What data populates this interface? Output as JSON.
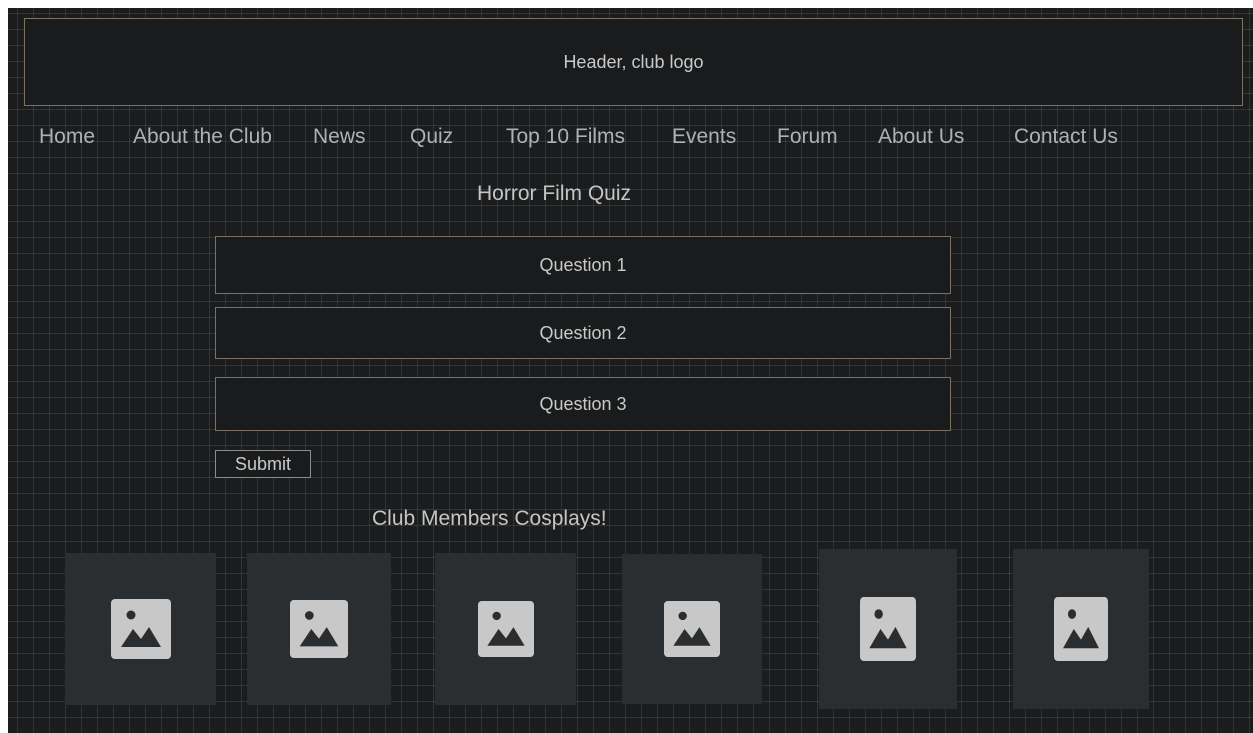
{
  "header": {
    "text": "Header, club logo"
  },
  "nav": {
    "items": [
      {
        "label": "Home"
      },
      {
        "label": "About the Club"
      },
      {
        "label": "News"
      },
      {
        "label": "Quiz"
      },
      {
        "label": "Top 10 Films"
      },
      {
        "label": "Events"
      },
      {
        "label": "Forum"
      },
      {
        "label": "About Us"
      },
      {
        "label": "Contact Us"
      }
    ]
  },
  "quiz": {
    "title": "Horror Film Quiz",
    "questions": [
      {
        "label": "Question 1"
      },
      {
        "label": "Question 2"
      },
      {
        "label": "Question 3"
      }
    ],
    "submit_label": "Submit"
  },
  "gallery": {
    "title": "Club Members Cosplays!",
    "images": [
      {
        "icon": "image-placeholder-icon"
      },
      {
        "icon": "image-placeholder-icon"
      },
      {
        "icon": "image-placeholder-icon"
      },
      {
        "icon": "image-placeholder-icon"
      },
      {
        "icon": "image-placeholder-icon"
      },
      {
        "icon": "image-placeholder-icon"
      }
    ]
  },
  "colors": {
    "background": "#1b1c1d",
    "box_border": "#7b735f",
    "text": "#c9c9c9",
    "tile": "#2b2e30",
    "icon": "#c8c8c8"
  }
}
